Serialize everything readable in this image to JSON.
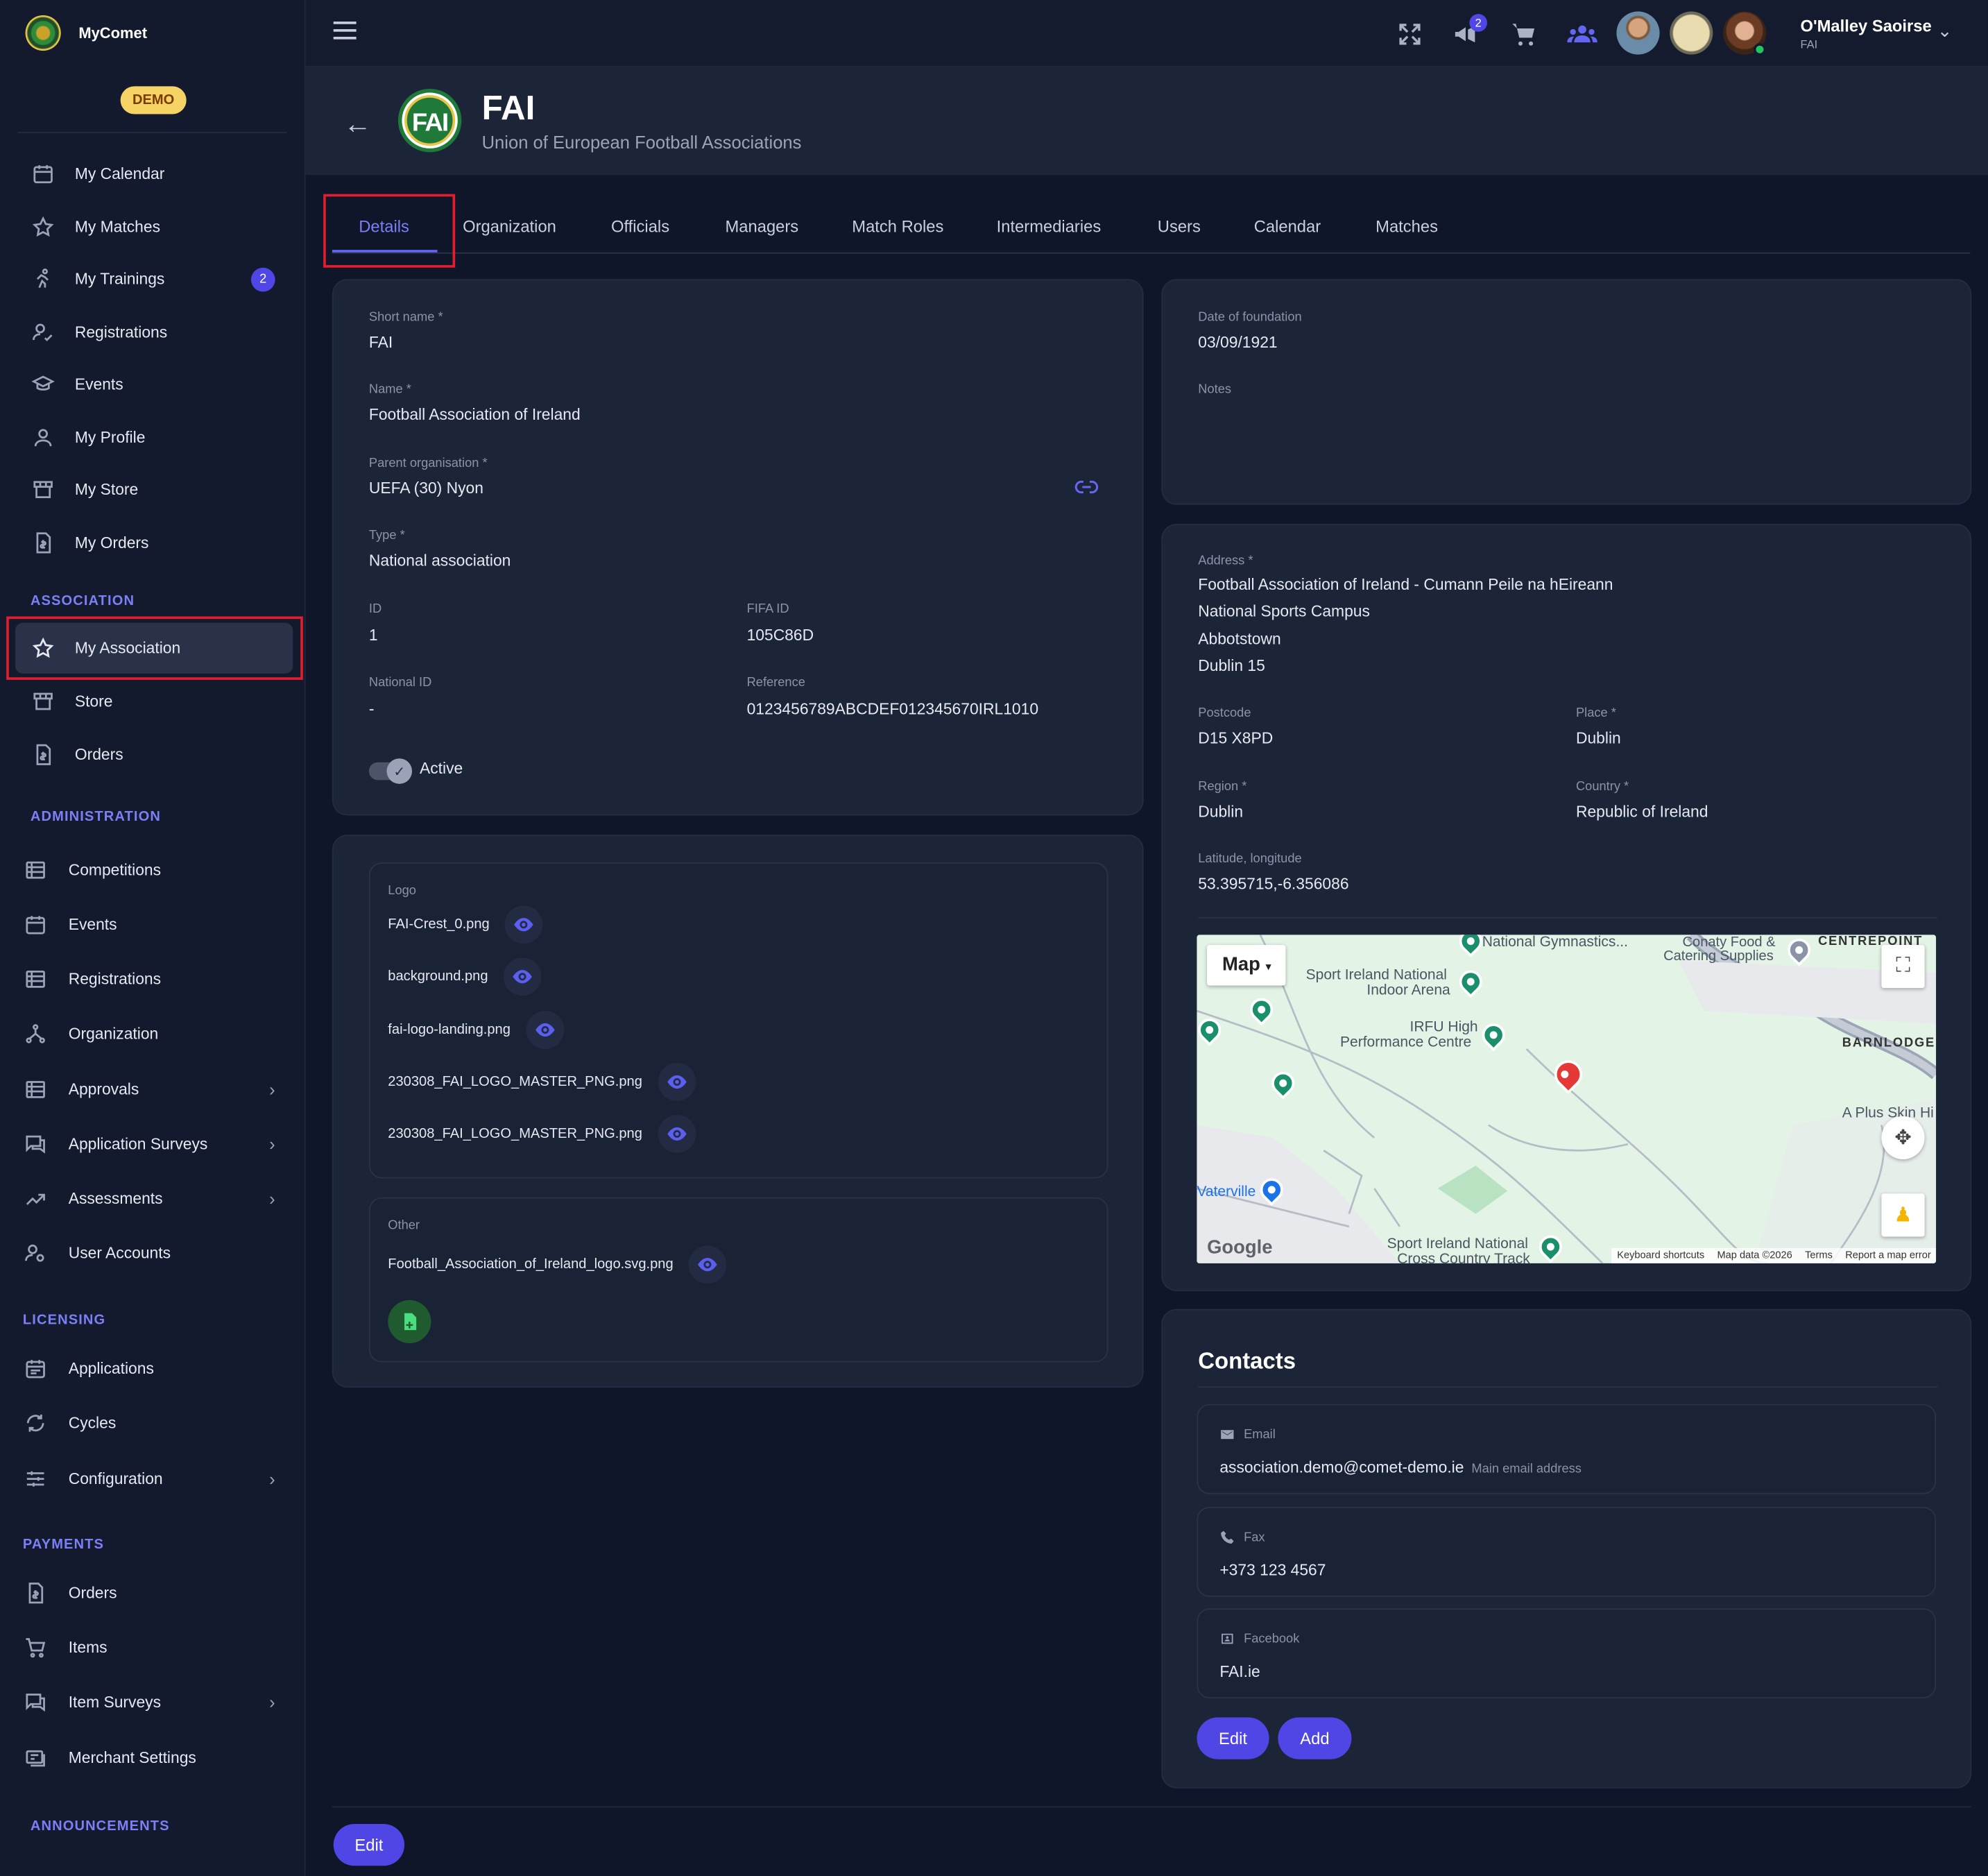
{
  "app": {
    "name": "MyComet",
    "env_badge": "DEMO"
  },
  "sidebar": {
    "items": [
      {
        "label": "My Calendar"
      },
      {
        "label": "My Matches"
      },
      {
        "label": "My Trainings",
        "badge": "2"
      },
      {
        "label": "Registrations"
      },
      {
        "label": "Events"
      },
      {
        "label": "My Profile"
      },
      {
        "label": "My Store"
      },
      {
        "label": "My Orders"
      }
    ],
    "sections": {
      "association": {
        "title": "ASSOCIATION",
        "items": [
          {
            "label": "My Association"
          },
          {
            "label": "Store"
          },
          {
            "label": "Orders"
          }
        ]
      },
      "administration": {
        "title": "ADMINISTRATION",
        "items": [
          {
            "label": "Competitions"
          },
          {
            "label": "Events"
          },
          {
            "label": "Registrations"
          },
          {
            "label": "Organization"
          },
          {
            "label": "Approvals"
          },
          {
            "label": "Application Surveys"
          },
          {
            "label": "Assessments"
          },
          {
            "label": "User Accounts"
          }
        ]
      },
      "licensing": {
        "title": "LICENSING",
        "items": [
          {
            "label": "Applications"
          },
          {
            "label": "Cycles"
          },
          {
            "label": "Configuration"
          }
        ]
      },
      "payments": {
        "title": "PAYMENTS",
        "items": [
          {
            "label": "Orders"
          },
          {
            "label": "Items"
          },
          {
            "label": "Item Surveys"
          },
          {
            "label": "Merchant Settings"
          }
        ]
      },
      "announcements": {
        "title": "ANNOUNCEMENTS"
      }
    }
  },
  "topbar": {
    "notification_count": "2",
    "user": {
      "name": "O'Malley Saoirse",
      "org": "FAI"
    }
  },
  "header": {
    "title": "FAI",
    "subtitle": "Union of European Football Associations",
    "logo_text": "FAI"
  },
  "tabs": [
    "Details",
    "Organization",
    "Officials",
    "Managers",
    "Match Roles",
    "Intermediaries",
    "Users",
    "Calendar",
    "Matches"
  ],
  "details": {
    "short_name": {
      "label": "Short name *",
      "value": "FAI"
    },
    "name": {
      "label": "Name *",
      "value": "Football Association of Ireland"
    },
    "parent": {
      "label": "Parent organisation *",
      "value": "UEFA (30) Nyon"
    },
    "type": {
      "label": "Type *",
      "value": "National association"
    },
    "id": {
      "label": "ID",
      "value": "1"
    },
    "fifa_id": {
      "label": "FIFA ID",
      "value": "105C86D"
    },
    "national_id": {
      "label": "National ID",
      "value": "-"
    },
    "reference": {
      "label": "Reference",
      "value": "0123456789ABCDEF012345670IRL1010"
    },
    "active_label": "Active",
    "active": true
  },
  "files": {
    "logo": {
      "label": "Logo",
      "items": [
        "FAI-Crest_0.png",
        "background.png",
        "fai-logo-landing.png",
        "230308_FAI_LOGO_MASTER_PNG.png",
        "230308_FAI_LOGO_MASTER_PNG.png"
      ]
    },
    "other": {
      "label": "Other",
      "items": [
        "Football_Association_of_Ireland_logo.svg.png"
      ]
    }
  },
  "foundation": {
    "date_label": "Date of foundation",
    "date": "03/09/1921",
    "notes_label": "Notes"
  },
  "address": {
    "label": "Address *",
    "lines": [
      "Football Association of Ireland - Cumann Peile na hEireann",
      "National Sports Campus",
      "Abbotstown",
      "Dublin 15"
    ],
    "postcode": {
      "label": "Postcode",
      "value": "D15 X8PD"
    },
    "place": {
      "label": "Place *",
      "value": "Dublin"
    },
    "region": {
      "label": "Region *",
      "value": "Dublin"
    },
    "country": {
      "label": "Country *",
      "value": "Republic of Ireland"
    },
    "latlng": {
      "label": "Latitude, longitude",
      "value": "53.395715,-6.356086"
    }
  },
  "map": {
    "type_label": "Map",
    "labels": [
      "National Gymnastics...",
      "Conaty Food &",
      "Catering Supplies",
      "CENTREPOINT",
      "Sport Ireland National",
      "Indoor Arena",
      "IRFU High",
      "Performance Centre",
      "BARNLODGE",
      "A Plus Skin Hi",
      "Vaterville",
      "Sport Ireland National",
      "Cross Country Track",
      "Google"
    ],
    "footer": [
      "Keyboard shortcuts",
      "Map data ©2026",
      "Terms",
      "Report a map error"
    ]
  },
  "contacts": {
    "title": "Contacts",
    "email": {
      "label": "Email",
      "value": "association.demo@comet-demo.ie",
      "note": "Main email address"
    },
    "fax": {
      "label": "Fax",
      "value": "+373 123 4567"
    },
    "facebook": {
      "label": "Facebook",
      "value": "FAI.ie"
    },
    "edit_label": "Edit",
    "add_label": "Add"
  },
  "footer": {
    "edit_label": "Edit"
  },
  "colors": {
    "accent": "#5046e5",
    "highlight": "#e11d2e",
    "background": "#0f1629",
    "card": "#1c2438"
  }
}
